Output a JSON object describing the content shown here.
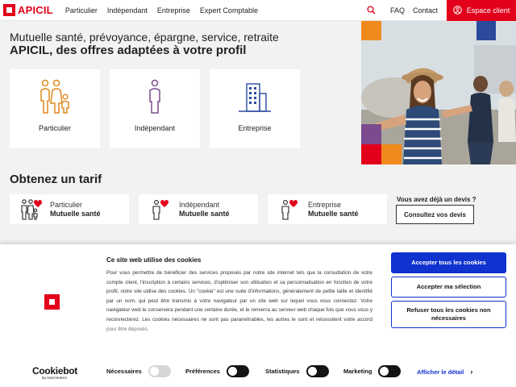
{
  "header": {
    "logo_text": "APICIL",
    "nav": [
      "Particulier",
      "Indépendant",
      "Entreprise",
      "Expert Comptable"
    ],
    "faq": "FAQ",
    "contact": "Contact",
    "espace_client": "Espace client",
    "brand_color": "#e2001a"
  },
  "hero": {
    "title_line1": "Mutuelle santé, prévoyance, épargne, service, retraite",
    "title_line2": "APICIL, des offres adaptées à votre profil",
    "cards": [
      {
        "label": "Particulier",
        "icon": "family-icon"
      },
      {
        "label": "Indépendant",
        "icon": "person-icon"
      },
      {
        "label": "Entreprise",
        "icon": "building-icon"
      }
    ]
  },
  "tarif": {
    "title": "Obtenez un tarif",
    "cards": [
      {
        "line1": "Particulier",
        "line2": "Mutuelle santé",
        "icon": "family-heart-icon"
      },
      {
        "line1": "Indépendant",
        "line2": "Mutuelle santé",
        "icon": "person-heart-icon"
      },
      {
        "line1": "Entreprise",
        "line2": "Mutuelle santé",
        "icon": "person-heart-icon"
      }
    ],
    "devis_question": "Vous avez déjà un devis ?",
    "devis_button": "Consultez vos devis"
  },
  "cookie": {
    "title": "Ce site web utilise des cookies",
    "body": "Pour vous permettre de bénéficier des services proposés par notre site internet tels que la consultation de votre compte client, l'inscription à certains services, d'optimiser son utilisation et sa personnalisation en fonction de votre profil, notre site utilise des cookies. Un \"cookie\" est une suite d'informations, généralement de petite taille et identifié par un nom, qui peut être transmis à votre navigateur par un site web sur lequel vous vous connectez. Votre navigateur web le conservera pendant une certaine durée, et le renverra au serveur web chaque fois que vous vous y reconnecterez. Les cookies nécessaires ne sont pas paramétrables, les autres le sont et nécessitent votre accord pour être déposés.",
    "accept_all": "Accepter tous les cookies",
    "accept_selection": "Accepter ma sélection",
    "refuse_all": "Refuser tous les cookies non nécessaires",
    "brand": "Cookiebot",
    "brand_sub": "by Usercentrics",
    "toggles": [
      {
        "label": "Nécessaires",
        "state": "disabled-on"
      },
      {
        "label": "Préférences",
        "state": "off"
      },
      {
        "label": "Statistiques",
        "state": "off"
      },
      {
        "label": "Marketing",
        "state": "off"
      }
    ],
    "detail_link": "Afficher le détail",
    "accent_color": "#1032cf"
  }
}
